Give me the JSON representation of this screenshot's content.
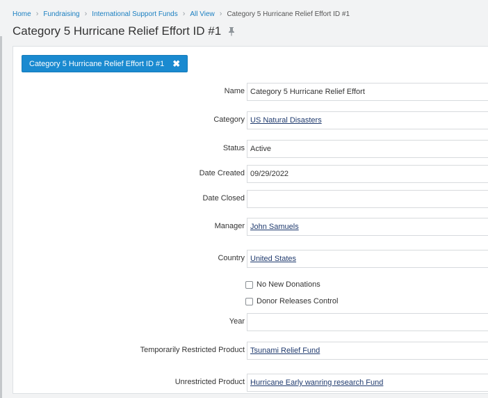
{
  "breadcrumb": {
    "items": [
      "Home",
      "Fundraising",
      "International Support Funds",
      "All View"
    ],
    "current": "Category 5 Hurricane Relief Effort ID #1"
  },
  "page": {
    "title": "Category 5 Hurricane Relief Effort ID #1",
    "pin_icon": "pin-icon"
  },
  "tab": {
    "label": "Category 5 Hurricane Relief Effort ID #1",
    "close_icon": "close-icon"
  },
  "fields": {
    "name": {
      "label": "Name",
      "value": "Category 5 Hurricane Relief Effort"
    },
    "category": {
      "label": "Category",
      "value": "US Natural Disasters"
    },
    "status": {
      "label": "Status",
      "value": "Active"
    },
    "date_created": {
      "label": "Date Created",
      "value": "09/29/2022"
    },
    "date_closed": {
      "label": "Date Closed",
      "value": ""
    },
    "manager": {
      "label": "Manager",
      "value": "John Samuels"
    },
    "country": {
      "label": "Country",
      "value": "United States"
    },
    "year": {
      "label": "Year",
      "value": ""
    },
    "temp_restricted_product": {
      "label": "Temporarily Restricted Product",
      "value": "Tsunami Relief Fund"
    },
    "unrestricted_product": {
      "label": "Unrestricted Product",
      "value": "Hurricane Early wanring research Fund"
    }
  },
  "checkboxes": {
    "no_new_donations": {
      "label": "No New Donations",
      "checked": false
    },
    "donor_releases_control": {
      "label": "Donor Releases Control",
      "checked": false
    }
  },
  "colors": {
    "link": "#1a7fc1",
    "tab_bg": "#1a8ad0",
    "value_link": "#1f3a6e"
  }
}
